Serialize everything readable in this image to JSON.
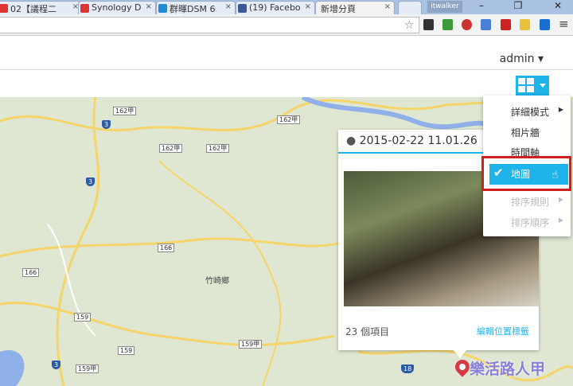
{
  "browser": {
    "tabs": [
      {
        "label": "02【議程二",
        "color": "#d33"
      },
      {
        "label": "Synology D",
        "color": "#d33"
      },
      {
        "label": "群暉DSM 6",
        "color": "#1b8dd6"
      },
      {
        "label": "(19) Facebo",
        "color": "#3b5998"
      },
      {
        "label": "新增分頁",
        "color": ""
      }
    ],
    "close": "×",
    "profile": "itwalker",
    "window_controls": [
      "–",
      "❐",
      "✕"
    ],
    "star": "☆",
    "menu": "≡"
  },
  "header": {
    "user": "admin ▾"
  },
  "map": {
    "roads": [
      "162甲",
      "162甲",
      "162甲",
      "162甲",
      "3",
      "3",
      "3",
      "166",
      "166",
      "159",
      "159",
      "159甲",
      "159甲",
      "18"
    ],
    "town": "竹崎鄉"
  },
  "popup": {
    "date": "2015-02-22 11.01.26",
    "count": "23 個項目",
    "edit_link": "編輯位置標籤"
  },
  "dropdown": {
    "items": [
      {
        "label": "詳細模式",
        "submenu": true,
        "disabled": false
      },
      {
        "label": "相片牆",
        "disabled": false
      },
      {
        "label": "時間軸",
        "disabled": false
      },
      {
        "label": "地圖",
        "selected": true
      },
      {
        "label": "排序規則",
        "submenu": true,
        "disabled": true
      },
      {
        "label": "排序順序",
        "submenu": true,
        "disabled": true
      }
    ],
    "check": "✔",
    "arrow": "▶"
  },
  "watermark": "樂活路人甲",
  "colors": {
    "accent": "#1eb4ea",
    "highlight": "#d0201c"
  }
}
